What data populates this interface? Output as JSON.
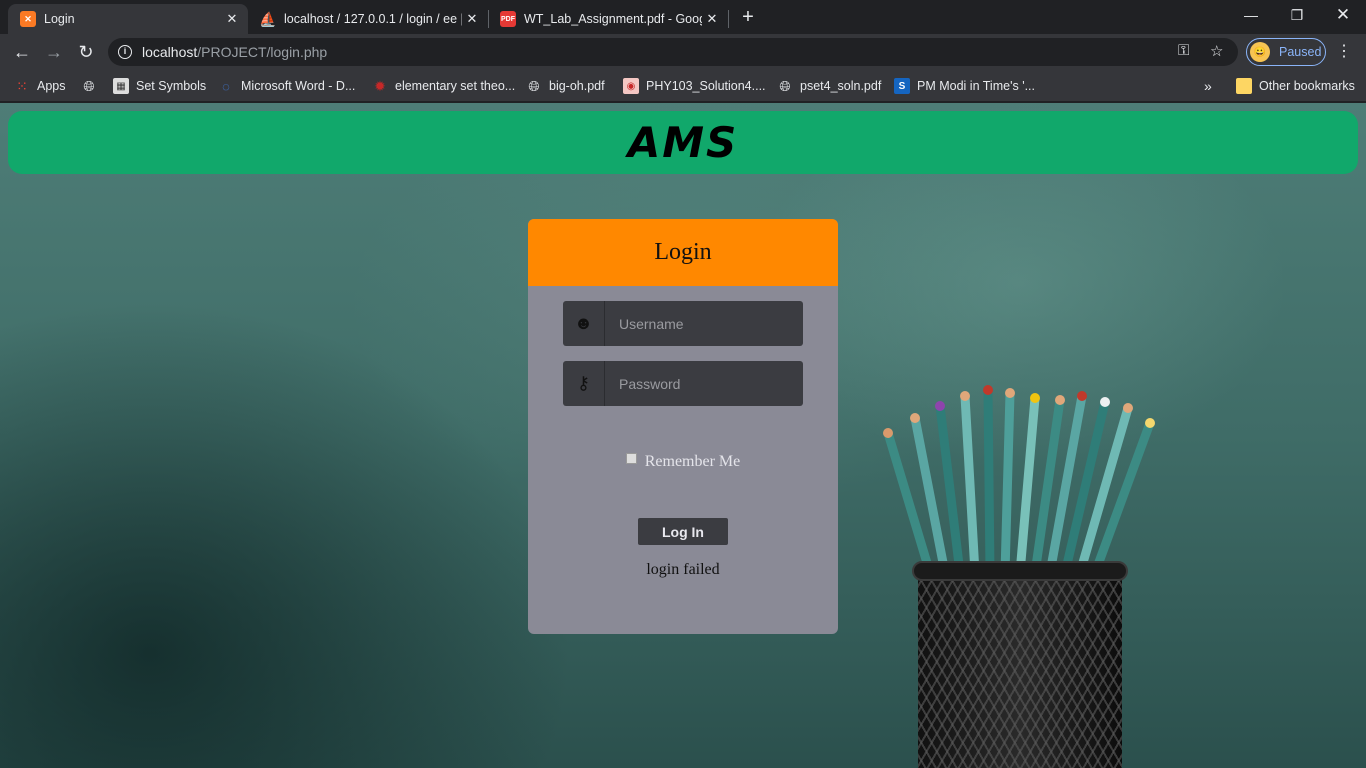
{
  "browser": {
    "tabs": [
      {
        "title": "Login",
        "favicon": "xampp-icon",
        "color": "#fb7a24"
      },
      {
        "title": "localhost / 127.0.0.1 / login / ee |",
        "favicon": "phpmyadmin-icon",
        "color": "#f29111"
      },
      {
        "title": "WT_Lab_Assignment.pdf - Googl",
        "favicon": "pdf-icon",
        "color": "#e53935"
      }
    ],
    "url_host": "localhost",
    "url_path": "/PROJECT/login.php",
    "profile_label": "Paused",
    "bookmarks": [
      {
        "label": "Apps"
      },
      {
        "label": "Set Symbols"
      },
      {
        "label": "Microsoft Word - D..."
      },
      {
        "label": "elementary set theo..."
      },
      {
        "label": "big-oh.pdf"
      },
      {
        "label": "PHY103_Solution4...."
      },
      {
        "label": "pset4_soln.pdf"
      },
      {
        "label": "PM Modi in Time's '..."
      }
    ],
    "overflow_label": "»",
    "other_bookmarks": "Other bookmarks"
  },
  "page": {
    "brand": "AMS",
    "brand_color": "#11a86b",
    "login_card": {
      "title": "Login",
      "header_color": "#ff8800",
      "username_placeholder": "Username",
      "password_placeholder": "Password",
      "remember_label": "Remember Me",
      "remember_checked": false,
      "submit_label": "Log In",
      "message": "login failed"
    }
  }
}
